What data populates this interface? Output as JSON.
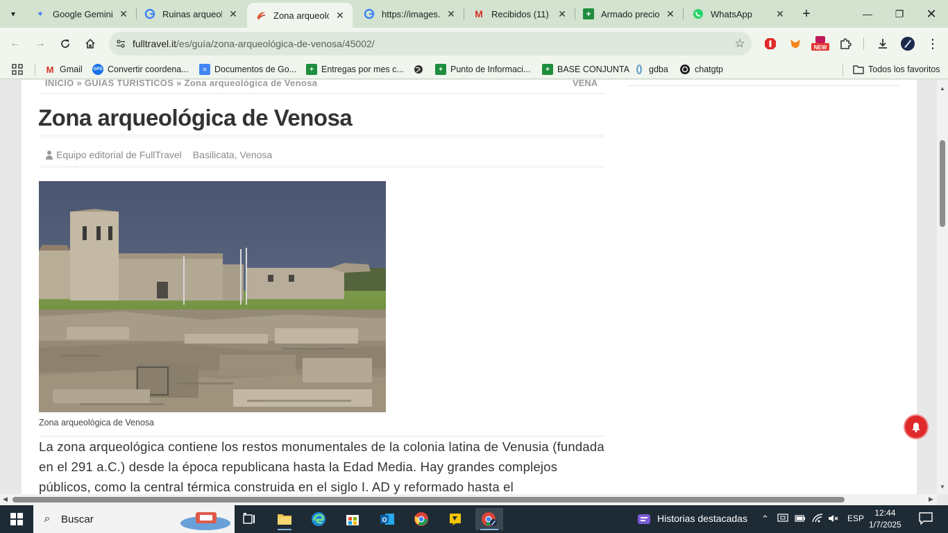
{
  "tabs": [
    {
      "title": "Google Gemini",
      "favicon": "gemini-icon",
      "active": false
    },
    {
      "title": "Ruinas arqueoló",
      "favicon": "google-icon",
      "active": false
    },
    {
      "title": "Zona arqueológ",
      "favicon": "fulltravel-icon",
      "active": true
    },
    {
      "title": "https://images.u",
      "favicon": "google-icon",
      "active": false
    },
    {
      "title": "Recibidos (11) -",
      "favicon": "gmail-icon",
      "active": false
    },
    {
      "title": "Armado precio C",
      "favicon": "sheets-icon",
      "active": false
    },
    {
      "title": "WhatsApp",
      "favicon": "whatsapp-icon",
      "active": false
    }
  ],
  "address": {
    "host": "fulltravel.it",
    "path": "/es/guía/zona-arqueológica-de-venosa/45002/"
  },
  "bookmarks": [
    {
      "label": "Gmail",
      "icon": "gmail-icon"
    },
    {
      "label": "Convertir coordena...",
      "icon": "gps-icon"
    },
    {
      "label": "Documentos de Go...",
      "icon": "docs-icon"
    },
    {
      "label": "Entregas por mes c...",
      "icon": "sheets-icon"
    },
    {
      "label": "",
      "icon": "globe-icon"
    },
    {
      "label": "Punto de Informaci...",
      "icon": "sheets-icon"
    },
    {
      "label": "BASE CONJUNTA",
      "icon": "sheets-icon"
    },
    {
      "label": "gdba",
      "icon": "gdba-icon"
    },
    {
      "label": "chatgtp",
      "icon": "openai-icon"
    }
  ],
  "all_bookmarks_label": "Todos los favoritos",
  "page": {
    "breadcrumb": "INICIO » GUÍAS TURÍSTICOS » Zona arqueológica de Venosa",
    "breadcrumb_right": "VENA",
    "title": "Zona arqueológica de Venosa",
    "author": "Equipo editorial de FullTravel",
    "location": "Basilicata, Venosa",
    "photo_caption": "Zona arqueológica de Venosa",
    "body": "La zona arqueológica contiene los restos monumentales de la colonia latina de Venusia (fundada en el 291 a.C.) desde la época republicana hasta la Edad Media. Hay grandes complejos públicos, como la central térmica construida en el siglo I. AD y reformado hasta el"
  },
  "taskbar": {
    "search_placeholder": "Buscar",
    "news_label": "Historias destacadas",
    "language": "ESP",
    "time": "12:44",
    "date": "1/7/2025"
  },
  "colors": {
    "tabstrip": "#d3e3d0",
    "toolbar": "#f0f6ee",
    "taskbar": "#1e2b35",
    "alert": "#e02a2a"
  }
}
